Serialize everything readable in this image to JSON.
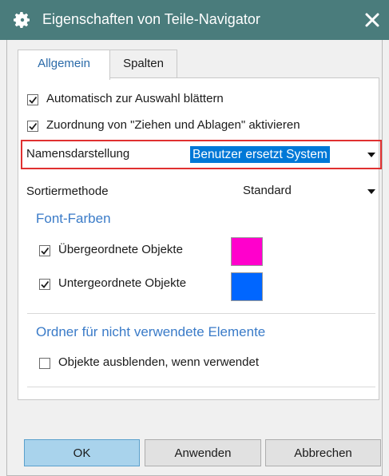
{
  "window": {
    "title": "Eigenschaften von Teile-Navigator",
    "titlebar_color": "#4a7c7c"
  },
  "tabs": [
    {
      "label": "Allgemein",
      "active": true
    },
    {
      "label": "Spalten",
      "active": false
    }
  ],
  "general": {
    "auto_scroll": {
      "label": "Automatisch zur Auswahl blättern",
      "checked": true
    },
    "drag_drop": {
      "label": "Zuordnung von \"Ziehen und Ablagen\" aktivieren",
      "checked": true
    },
    "name_display": {
      "label": "Namensdarstellung",
      "value": "Benutzer ersetzt System"
    },
    "sort_method": {
      "label": "Sortiermethode",
      "value": "Standard"
    }
  },
  "font_colors": {
    "heading": "Font-Farben",
    "parent": {
      "label": "Übergeordnete Objekte",
      "checked": true,
      "color": "#ff00cc"
    },
    "child": {
      "label": "Untergeordnete Objekte",
      "checked": true,
      "color": "#0066ff"
    }
  },
  "unused_folder": {
    "heading": "Ordner für nicht verwendete Elemente",
    "hide": {
      "label": "Objekte ausblenden, wenn verwendet",
      "checked": false
    }
  },
  "buttons": {
    "ok": "OK",
    "apply": "Anwenden",
    "cancel": "Abbrechen"
  },
  "colors": {
    "accent": "#3a7bc8",
    "highlight_border": "#e03030",
    "selection": "#0078d7"
  }
}
